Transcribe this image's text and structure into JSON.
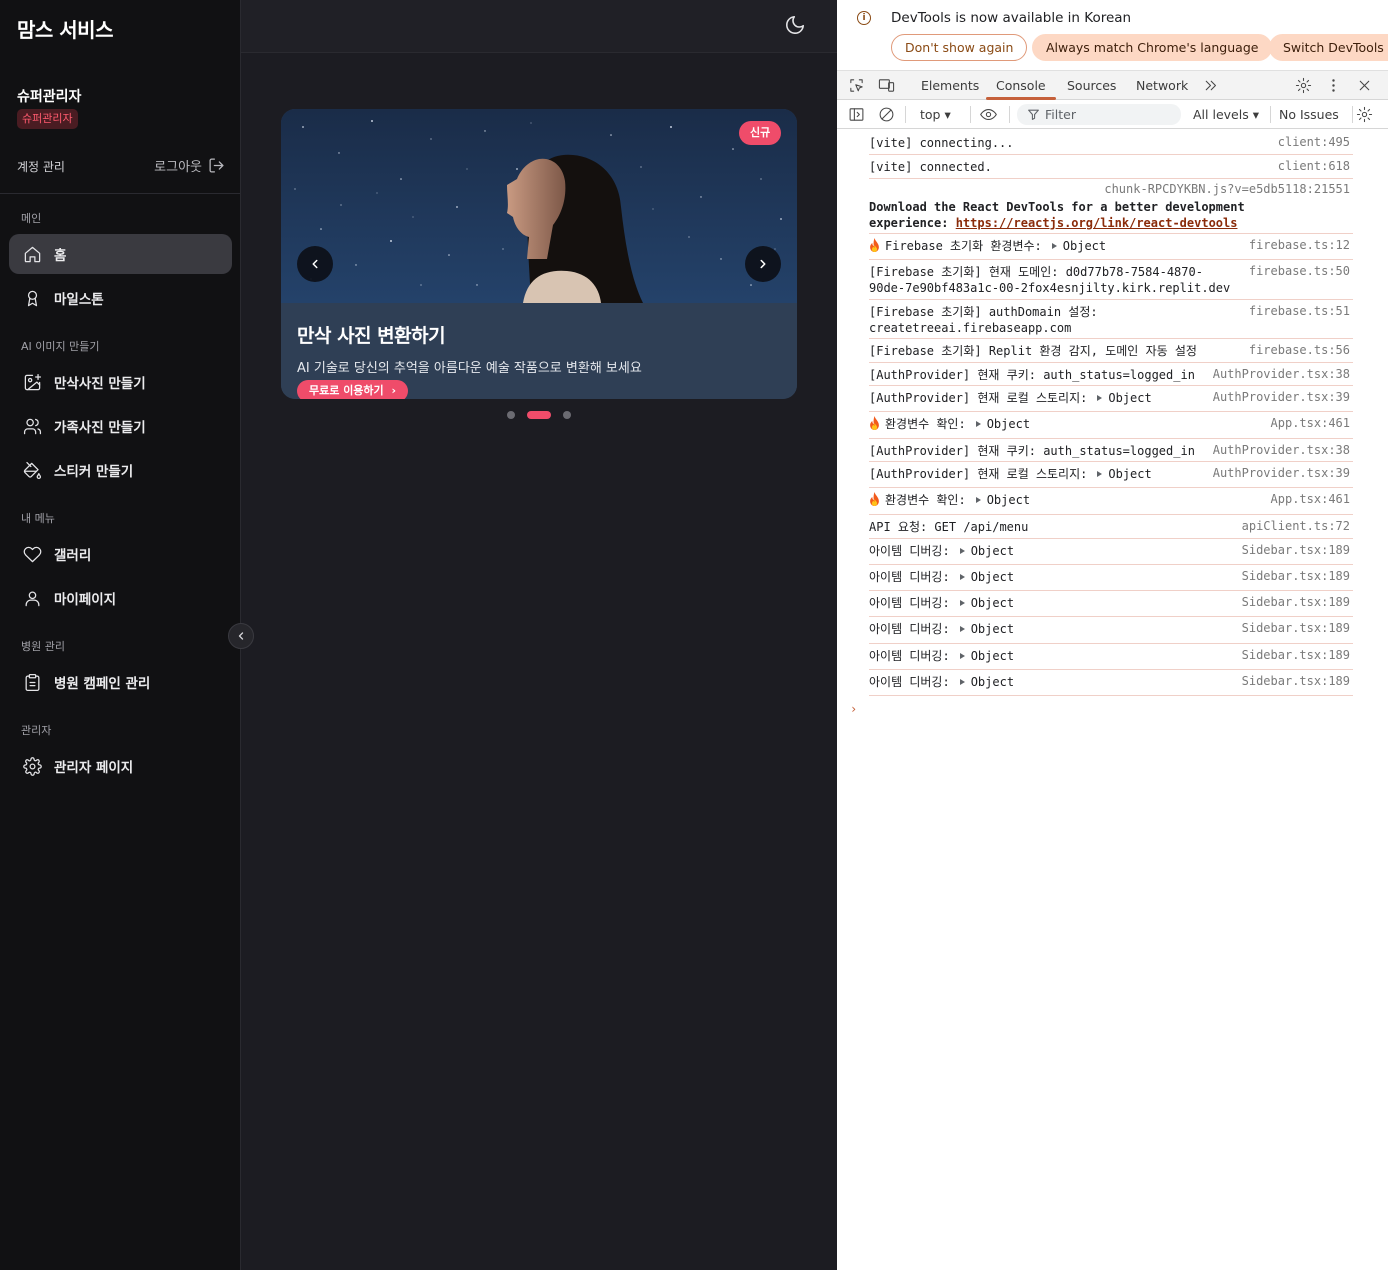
{
  "sidebar": {
    "brand": "맘스 서비스",
    "user_name": "슈퍼관리자",
    "role_badge": "슈퍼관리자",
    "account_label": "계정 관리",
    "logout_label": "로그아웃",
    "sections": {
      "main": "메인",
      "ai": "AI 이미지 만들기",
      "my": "내 메뉴",
      "hospital": "병원 관리",
      "admin": "관리자"
    },
    "items": [
      {
        "label": "홈",
        "icon": "home-icon"
      },
      {
        "label": "마일스톤",
        "icon": "award-icon"
      },
      {
        "label": "만삭사진 만들기",
        "icon": "image-plus-icon"
      },
      {
        "label": "가족사진 만들기",
        "icon": "users-icon"
      },
      {
        "label": "스티커 만들기",
        "icon": "paint-bucket-icon"
      },
      {
        "label": "갤러리",
        "icon": "heart-icon"
      },
      {
        "label": "마이페이지",
        "icon": "user-icon"
      },
      {
        "label": "병원 캠페인 관리",
        "icon": "clipboard-icon"
      },
      {
        "label": "관리자 페이지",
        "icon": "settings-icon"
      }
    ]
  },
  "main": {
    "banner": {
      "badge": "신규",
      "title": "만삭 사진 변환하기",
      "description": "AI 기술로 당신의 추억을 아름다운 예술 작품으로 변환해 보세요",
      "cta": "무료로 이용하기"
    },
    "carousel": {
      "count": 3,
      "active_index": 1
    }
  },
  "devtools": {
    "infobar": {
      "message": "DevTools is now available in Korean",
      "buttons": [
        "Don't show again",
        "Always match Chrome's language",
        "Switch DevTools t"
      ]
    },
    "tabs": [
      "Elements",
      "Console",
      "Sources",
      "Network"
    ],
    "active_tab": "Console",
    "toolbar": {
      "context": "top",
      "filter_placeholder": "Filter",
      "levels": "All levels",
      "issues": "No Issues"
    },
    "logs": [
      {
        "msg": "[vite] connecting...",
        "src": "client:495"
      },
      {
        "msg": "[vite] connected.",
        "src": "client:618"
      },
      {
        "src": "chunk-RPCDYKBN.js?v=e5db5118:21551",
        "bold_line1": "Download the React DevTools for a better development",
        "bold_line2": "experience: ",
        "link": "https://reactjs.org/link/react-devtools"
      },
      {
        "msg": "Firebase 초기화 환경변수:",
        "obj": "Object",
        "src": "firebase.ts:12",
        "fire": true
      },
      {
        "msg": "[Firebase 초기화] 현재 도메인: d0d77b78-7584-4870-\n90de-7e90bf483a1c-00-2fox4esnjilty.kirk.replit.dev",
        "src": "firebase.ts:50"
      },
      {
        "msg": "[Firebase 초기화] authDomain 설정:\ncreatetreeai.firebaseapp.com",
        "src": "firebase.ts:51"
      },
      {
        "msg": "[Firebase 초기화] Replit 환경 감지, 도메인 자동 설정",
        "src": "firebase.ts:56"
      },
      {
        "msg": "[AuthProvider] 현재 쿠키: auth_status=logged_in",
        "src": "AuthProvider.tsx:38"
      },
      {
        "msg": "[AuthProvider] 현재 로컬 스토리지:",
        "obj": "Object",
        "src": "AuthProvider.tsx:39"
      },
      {
        "msg": "환경변수 확인:",
        "obj": "Object",
        "src": "App.tsx:461",
        "fire": true
      },
      {
        "msg": "[AuthProvider] 현재 쿠키: auth_status=logged_in",
        "src": "AuthProvider.tsx:38"
      },
      {
        "msg": "[AuthProvider] 현재 로컬 스토리지:",
        "obj": "Object",
        "src": "AuthProvider.tsx:39"
      },
      {
        "msg": "환경변수 확인:",
        "obj": "Object",
        "src": "App.tsx:461",
        "fire": true
      },
      {
        "msg": "API 요청: GET /api/menu",
        "src": "apiClient.ts:72"
      },
      {
        "msg": "아이템 디버깅:",
        "obj": "Object",
        "src": "Sidebar.tsx:189"
      },
      {
        "msg": "아이템 디버깅:",
        "obj": "Object",
        "src": "Sidebar.tsx:189"
      },
      {
        "msg": "아이템 디버깅:",
        "obj": "Object",
        "src": "Sidebar.tsx:189"
      },
      {
        "msg": "아이템 디버깅:",
        "obj": "Object",
        "src": "Sidebar.tsx:189"
      },
      {
        "msg": "아이템 디버깅:",
        "obj": "Object",
        "src": "Sidebar.tsx:189"
      },
      {
        "msg": "아이템 디버깅:",
        "obj": "Object",
        "src": "Sidebar.tsx:189"
      }
    ],
    "prompt": "›"
  },
  "colors": {
    "accent": "#ef4c6a",
    "sidebar_bg": "#111113",
    "main_bg": "#1c1c22",
    "devtools_accent": "#c5603a"
  }
}
